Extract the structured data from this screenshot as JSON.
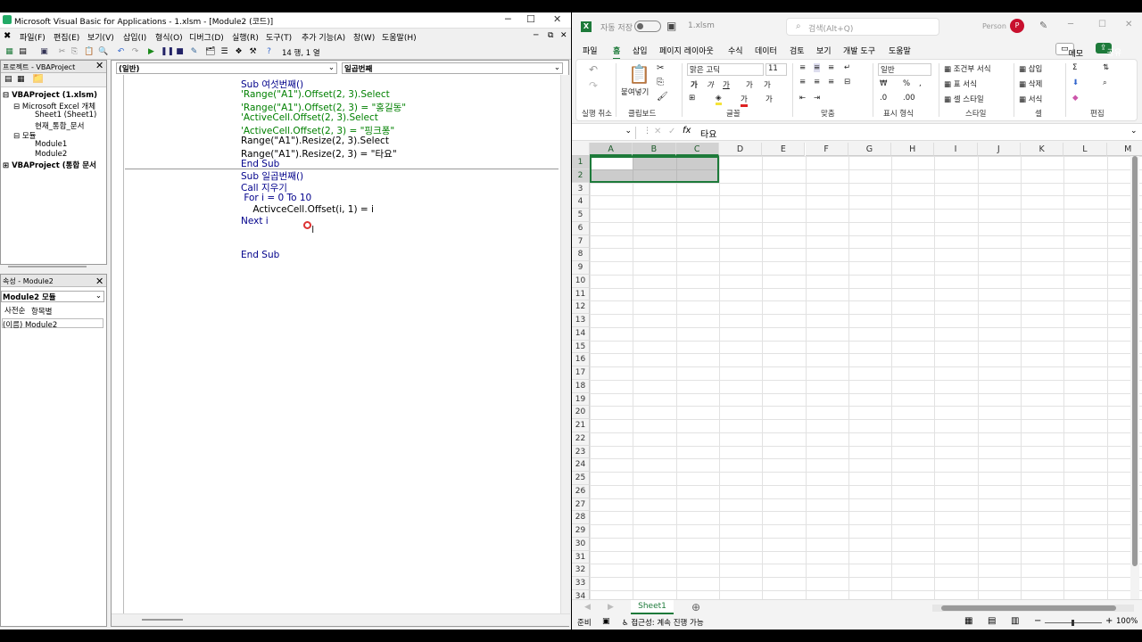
{
  "vba": {
    "title": "Microsoft Visual Basic for Applications - 1.xlsm - [Module2 (코드)]",
    "menu": [
      "파일(F)",
      "편집(E)",
      "보기(V)",
      "삽입(I)",
      "형식(O)",
      "디버그(D)",
      "실행(R)",
      "도구(T)",
      "추가 기능(A)",
      "창(W)",
      "도움말(H)"
    ],
    "toolbar_position": "14 행, 1 열",
    "project_pane_title": "프로젝트 - VBAProject",
    "tree": [
      "VBAProject (1.xlsm)",
      "Microsoft Excel 개체",
      "Sheet1 (Sheet1)",
      "현재_통합_문서",
      "모듈",
      "Module1",
      "Module2",
      "VBAProject (통합 문서"
    ],
    "props_title": "속성 - Module2",
    "props_select": "Module2 모듈",
    "props_tabs": [
      "사전순",
      "항목별"
    ],
    "props_row": "(이름) Module2",
    "object_dropdown": "(일반)",
    "proc_dropdown": "일곱번째",
    "code_lines": [
      "Sub 여섯번째()",
      "'Range(\"A1\").Offset(2, 3).Select",
      "'Range(\"A1\").Offset(2, 3) = \"홍길동\"",
      "'ActiveCell.Offset(2, 3).Select",
      "'ActiveCell.Offset(2, 3) = \"핑크퐁\"",
      "Range(\"A1\").Resize(2, 3).Select",
      "Range(\"A1\").Resize(2, 3) = \"타요\"",
      "End Sub",
      "Sub 일곱번째()",
      "Call 지우기",
      " For i = 0 To 10",
      "    ActivceCell.Offset(i, 1) = i",
      "Next i",
      "End Sub"
    ]
  },
  "excel": {
    "autosave": "자동 저장",
    "filename": "1.xlsm",
    "search": "검색(Alt+Q)",
    "user": "Person",
    "avatar": "P",
    "tabs": [
      "파일",
      "홈",
      "삽입",
      "페이지 레이아웃",
      "수식",
      "데이터",
      "검토",
      "보기",
      "개발 도구",
      "도움말"
    ],
    "memo": "메모",
    "share": "공유",
    "groups": [
      "실행 취소",
      "클립보드",
      "글꼴",
      "맞춤",
      "표시 형식",
      "스타일",
      "셀",
      "편집"
    ],
    "paste": "붙여넣기",
    "font": "맑은 고딕",
    "font_size": "11",
    "number_format": "일반",
    "styles": [
      "조건부 서식",
      "표 서식",
      "셀 스타일"
    ],
    "cells_ops": [
      "삽입",
      "삭제",
      "서식"
    ],
    "formula_value": "타요",
    "fx": "fx",
    "columns": [
      "A",
      "B",
      "C",
      "D",
      "E",
      "F",
      "G",
      "H",
      "I",
      "J",
      "K",
      "L",
      "M"
    ],
    "rows": [
      "1",
      "2",
      "3",
      "4",
      "5",
      "6",
      "7",
      "8",
      "9",
      "10",
      "11",
      "12",
      "13",
      "14",
      "15",
      "16",
      "17",
      "18",
      "19",
      "20",
      "21",
      "22",
      "23",
      "24",
      "25",
      "26",
      "27",
      "28",
      "29",
      "30",
      "31",
      "32",
      "33",
      "34"
    ],
    "sheet": "Sheet1",
    "status_ready": "준비",
    "status_access": "접근성: 계속 진행 가능",
    "zoom": "100%"
  }
}
